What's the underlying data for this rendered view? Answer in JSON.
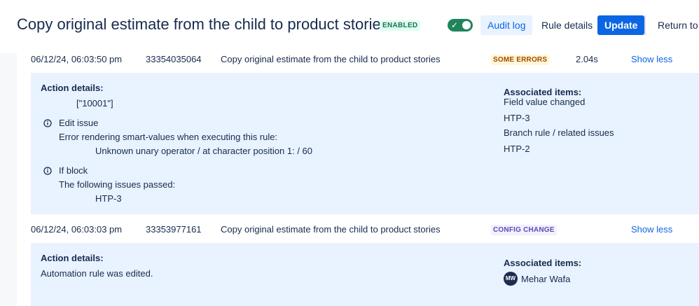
{
  "header": {
    "title": "Copy original estimate from the child to product stories",
    "status_badge": "ENABLED",
    "audit_log_label": "Audit log",
    "rule_details_label": "Rule details",
    "update_label": "Update",
    "return_label": "Return to r"
  },
  "entries": [
    {
      "date": "06/12/24, 06:03:50 pm",
      "id": "33354035064",
      "rule_name": "Copy original estimate from the child to product stories",
      "status": "SOME ERRORS",
      "duration": "2.04s",
      "toggle_label": "Show less",
      "action_details_label": "Action details:",
      "action_value": "[\"10001\"]",
      "edit_issue": {
        "title": "Edit issue",
        "message": "Error rendering smart-values when executing this rule:",
        "detail": "Unknown unary operator / at character position 1: / 60"
      },
      "if_block": {
        "title": "If block",
        "message": "The following issues passed:",
        "detail": "HTP-3"
      },
      "associated": {
        "label": "Associated items:",
        "group1": "Field value changed",
        "link1": "HTP-3",
        "group2": "Branch rule / related issues",
        "link2": "HTP-2"
      }
    },
    {
      "date": "06/12/24, 06:03:03 pm",
      "id": "33353977161",
      "rule_name": "Copy original estimate from the child to product stories",
      "status": "CONFIG CHANGE",
      "toggle_label": "Show less",
      "action_details_label": "Action details:",
      "action_message": "Automation rule was edited.",
      "associated": {
        "label": "Associated items:",
        "avatar_initials": "MW",
        "user": "Mehar Wafa"
      }
    }
  ],
  "colors": {
    "accent": "#0C66E4",
    "panel_bg": "#E9F2FF",
    "success": "#1F845A",
    "warning_bg": "#FFF7D6",
    "warning_text": "#A54800",
    "config_bg": "#F3F0FF",
    "config_text": "#5E4DB2"
  },
  "icons": [
    "check-icon",
    "info-icon"
  ]
}
